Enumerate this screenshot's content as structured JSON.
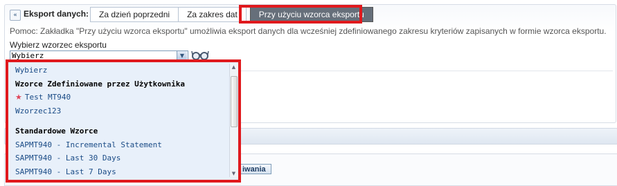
{
  "header": {
    "collapse_glyph": "«",
    "export_label": "Eksport danych:"
  },
  "tabs": [
    {
      "label": "Za dzień poprzedni",
      "active": false
    },
    {
      "label": "Za zakres dat",
      "active": false
    },
    {
      "label": "Przy użyciu wzorca eksportu",
      "active": true
    }
  ],
  "help_text": "Pomoc: Zakładka \"Przy użyciu wzorca eksportu\" umożliwia eksport danych dla wcześniej zdefiniowanego zakresu kryteriów zapisanych w formie wzorca eksportu.",
  "template_select": {
    "label": "Wybierz wzorzec eksportu",
    "selected": "Wybierz"
  },
  "dropdown": {
    "items": [
      {
        "label": "Wybierz",
        "type": "option"
      },
      {
        "label": "Wzorce Zdefiniowane przez Użytkownika",
        "type": "group"
      },
      {
        "label": "Test MT940",
        "type": "option",
        "icon": "star-icon"
      },
      {
        "label": "Wzorzec123",
        "type": "option"
      },
      {
        "label": "Standardowe Wzorce",
        "type": "group"
      },
      {
        "label": "SAPMT940 - Incremental Statement",
        "type": "option"
      },
      {
        "label": "SAPMT940 - Last 30 Days",
        "type": "option"
      },
      {
        "label": "SAPMT940 - Last 7 Days",
        "type": "option"
      }
    ]
  },
  "run_button_label": "iwania",
  "colors": {
    "highlight": "#e0191d",
    "active_tab": "#666f7a",
    "dropdown_bg": "#e8f0fa",
    "link": "#1a4b86"
  }
}
